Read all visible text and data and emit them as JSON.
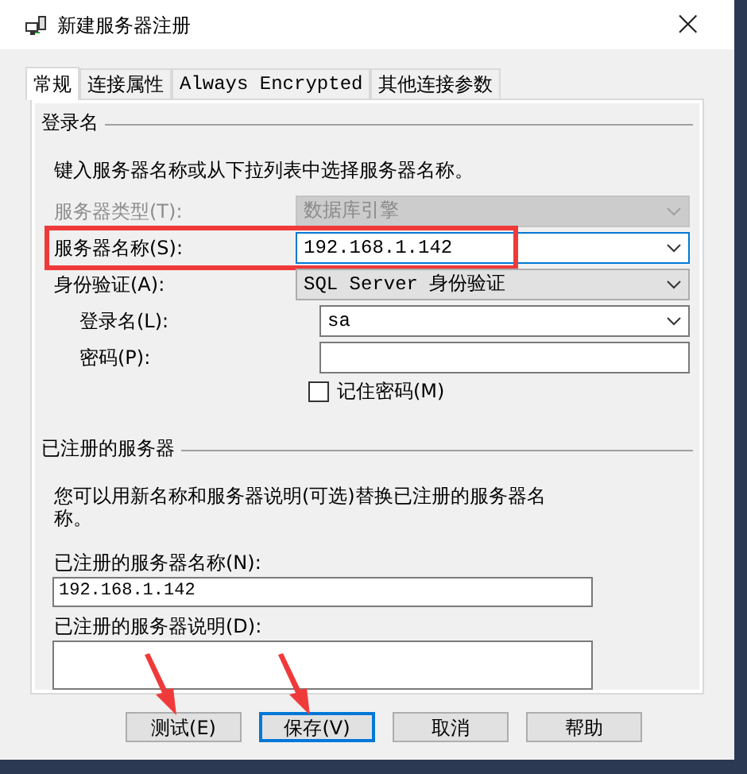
{
  "window": {
    "title": "新建服务器注册",
    "close": "×"
  },
  "tabs": [
    {
      "label": "常规",
      "selected": true
    },
    {
      "label": "连接属性",
      "selected": false
    },
    {
      "label": "Always Encrypted",
      "selected": false
    },
    {
      "label": "其他连接参数",
      "selected": false
    }
  ],
  "login_group": {
    "title": "登录名",
    "instruction": "键入服务器名称或从下拉列表中选择服务器名称。",
    "fields": [
      {
        "label": "服务器类型(T):",
        "value": "数据库引擎",
        "kind": "combo",
        "disabled": true,
        "indent": false,
        "highlighted": false
      },
      {
        "label": "服务器名称(S):",
        "value": "192.168.1.142",
        "kind": "combo",
        "disabled": false,
        "indent": false,
        "highlighted": true
      },
      {
        "label": "身份验证(A):",
        "value": "SQL Server 身份验证",
        "kind": "dropdown",
        "disabled": false,
        "indent": false,
        "highlighted": false
      },
      {
        "label": "登录名(L):",
        "value": "sa",
        "kind": "combo",
        "disabled": false,
        "indent": true,
        "highlighted": false
      },
      {
        "label": "密码(P):",
        "kind": "text",
        "disabled": false,
        "indent": true,
        "highlighted": false
      }
    ],
    "remember": {
      "label": "记住密码(M)",
      "checked": false
    }
  },
  "registered_group": {
    "title": "已注册的服务器",
    "instruction": "您可以用新名称和服务器说明(可选)替换已注册的服务器名称。",
    "name_label": "已注册的服务器名称(N):",
    "name_value": "192.168.1.142",
    "description_label": "已注册的服务器说明(D):"
  },
  "buttons": [
    {
      "label": "测试(E)",
      "default": false,
      "arrow": true
    },
    {
      "label": "保存(V)",
      "default": true,
      "arrow": true
    },
    {
      "label": "取消",
      "default": false,
      "arrow": false
    },
    {
      "label": "帮助",
      "default": false,
      "arrow": false
    }
  ]
}
